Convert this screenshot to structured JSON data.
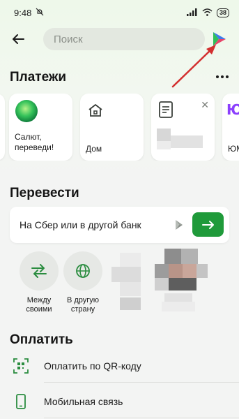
{
  "status": {
    "time": "9:48",
    "battery": "38"
  },
  "search": {
    "placeholder": "Поиск"
  },
  "payments": {
    "title": "Платежи",
    "cards": [
      {
        "label": "Салют, переведи!",
        "icon": "salut-assistant-icon"
      },
      {
        "label": "Дом",
        "icon": "home-icon"
      },
      {
        "label": "",
        "icon": "document-icon"
      },
      {
        "label": "ЮМ",
        "icon": "yumoney-logo-icon"
      }
    ]
  },
  "transfer": {
    "title": "Перевести",
    "field_label": "На Сбер или в другой банк",
    "quick": [
      {
        "label": "Между своими",
        "icon": "exchange-arrows-icon"
      },
      {
        "label": "В другую страну",
        "icon": "globe-icon"
      }
    ]
  },
  "pay": {
    "title": "Оплатить",
    "items": [
      {
        "label": "Оплатить по QR-коду",
        "icon": "qr-scan-icon"
      },
      {
        "label": "Мобильная связь",
        "icon": "mobile-phone-icon"
      }
    ]
  },
  "colors": {
    "accent": "#1f9a3a",
    "annotation": "#d32f2f"
  }
}
